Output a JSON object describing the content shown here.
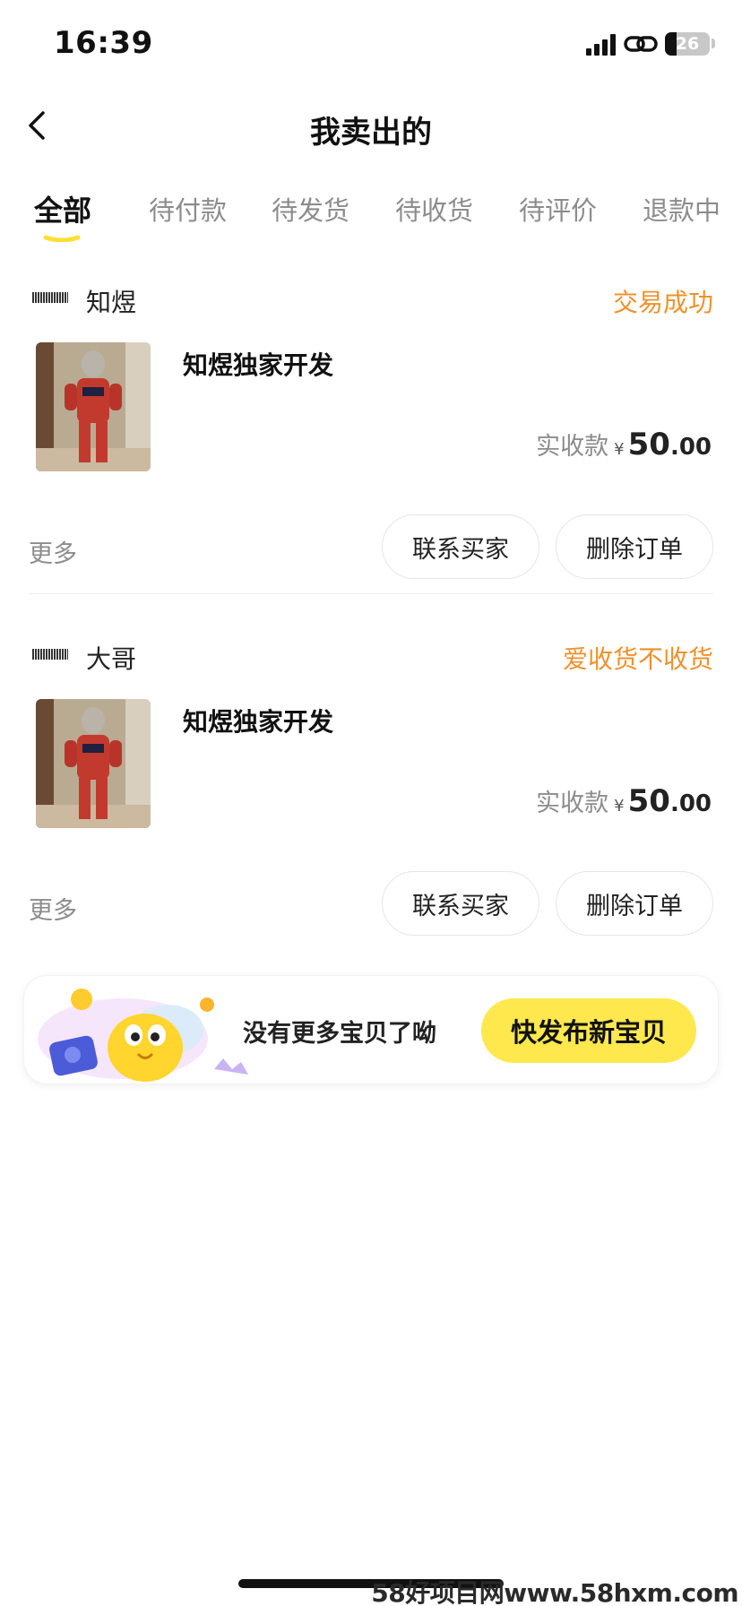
{
  "status_bar": {
    "time": "16:39",
    "battery": "26",
    "battery_level": 0.26
  },
  "nav": {
    "title": "我卖出的"
  },
  "tabs": [
    {
      "label": "全部",
      "active": true
    },
    {
      "label": "待付款"
    },
    {
      "label": "待发货"
    },
    {
      "label": "待收货"
    },
    {
      "label": "待评价"
    },
    {
      "label": "退款中"
    }
  ],
  "orders": [
    {
      "buyer_name": "知煜",
      "status": "交易成功",
      "item_title": "知煜独家开发",
      "price_label": "实收款",
      "currency": "¥",
      "price_int": "50",
      "price_dec": ".00",
      "more": "更多",
      "contact_label": "联系买家",
      "delete_label": "删除订单"
    },
    {
      "buyer_name": "大哥",
      "status": "爱收货不收货",
      "item_title": "知煜独家开发",
      "price_label": "实收款",
      "currency": "¥",
      "price_int": "50",
      "price_dec": ".00",
      "more": "更多",
      "contact_label": "联系买家",
      "delete_label": "删除订单"
    }
  ],
  "footer": {
    "text": "没有更多宝贝了呦",
    "button": "快发布新宝贝"
  },
  "watermark": "58好项目网www.58hxm.com",
  "colors": {
    "status_orange": "#f0912b",
    "accent_yellow": "#ffe84d",
    "tab_inactive": "#8c8c8c"
  }
}
